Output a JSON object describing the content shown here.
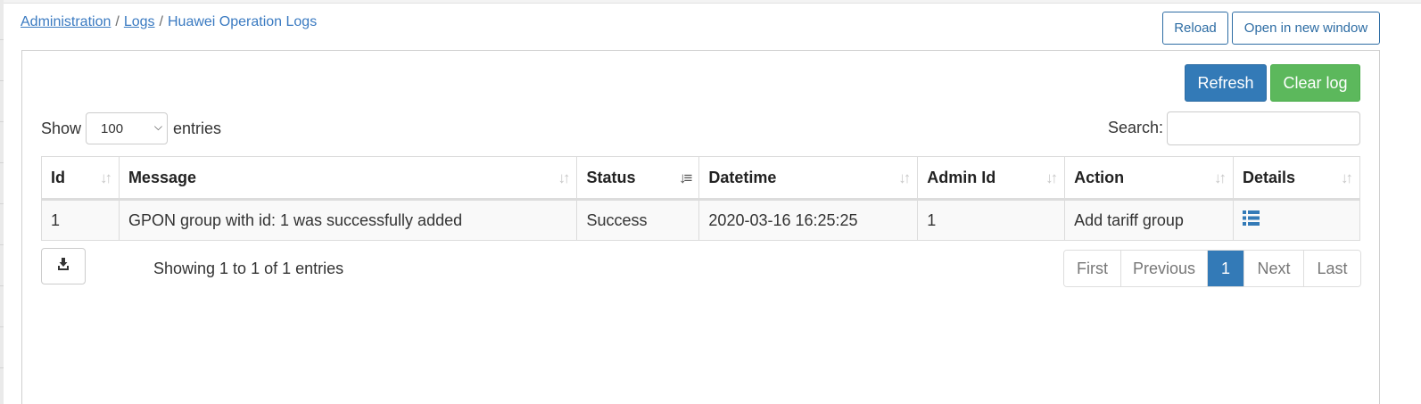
{
  "breadcrumb": {
    "items": [
      "Administration",
      "Logs"
    ],
    "separator": "/",
    "current": "Huawei Operation Logs"
  },
  "top_actions": {
    "reload": "Reload",
    "open_new_window": "Open in new window"
  },
  "toolbar": {
    "refresh": "Refresh",
    "clear_log": "Clear log"
  },
  "length_menu": {
    "show": "Show",
    "selected": "100",
    "entries": "entries"
  },
  "search": {
    "label": "Search:",
    "value": ""
  },
  "table": {
    "columns": [
      "Id",
      "Message",
      "Status",
      "Datetime",
      "Admin Id",
      "Action",
      "Details"
    ],
    "sorted_column": "Status",
    "rows": [
      {
        "id": "1",
        "message": "GPON group with id: 1 was successfully added",
        "status": "Success",
        "datetime": "2020-03-16 16:25:25",
        "admin_id": "1",
        "action": "Add tariff group",
        "details_icon": "list-icon"
      }
    ]
  },
  "info": "Showing 1 to 1 of 1 entries",
  "pagination": {
    "first": "First",
    "previous": "Previous",
    "current": "1",
    "next": "Next",
    "last": "Last"
  },
  "colors": {
    "primary": "#337ab7",
    "success": "#5cb85c",
    "link": "#3a7ac1"
  }
}
